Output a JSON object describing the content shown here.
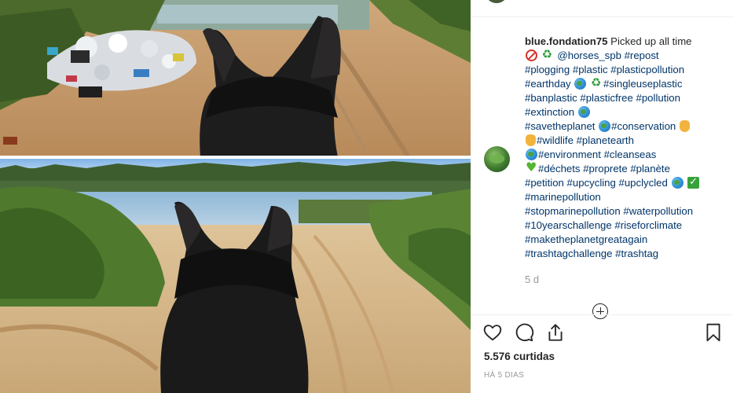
{
  "post": {
    "username": "blue.fondation75",
    "caption_intro": "Picked up all time",
    "lines": [
      [
        "@horses_spb",
        "#repost"
      ],
      [
        "#plogging",
        "#plastic",
        "#plasticpollution"
      ],
      [
        "#earthday",
        "#singleuseplastic"
      ],
      [
        "#banplastic",
        "#plasticfree",
        "#pollution"
      ],
      [
        "#extinction"
      ],
      [
        "#savetheplanet",
        "#conservation"
      ],
      [
        "#wildlife",
        "#planetearth"
      ],
      [
        "#environment",
        "#cleanseas"
      ],
      [
        "#déchets",
        "#proprete",
        "#planète"
      ],
      [
        "#petition",
        "#upcycling",
        "#upclycled"
      ],
      [
        "#marinepollution"
      ],
      [
        "#stopmarinepollution",
        "#waterpollution"
      ],
      [
        "#10yearschallenge",
        "#riseforclimate"
      ],
      [
        "#maketheplanetgreatagain"
      ],
      [
        "#trashtagchallenge",
        "#trashtag"
      ]
    ],
    "relative_time": "5 d",
    "likes": "5.576 curtidas",
    "date": "HÁ 5 DIAS"
  },
  "icons": {
    "like": "heart-icon",
    "comment": "comment-bubble-icon",
    "share": "share-upload-icon",
    "save": "bookmark-icon",
    "load_more": "plus-circle-icon"
  },
  "colors": {
    "text": "#262626",
    "hashtag": "#003569",
    "muted": "#999999",
    "divider": "#efefef"
  }
}
